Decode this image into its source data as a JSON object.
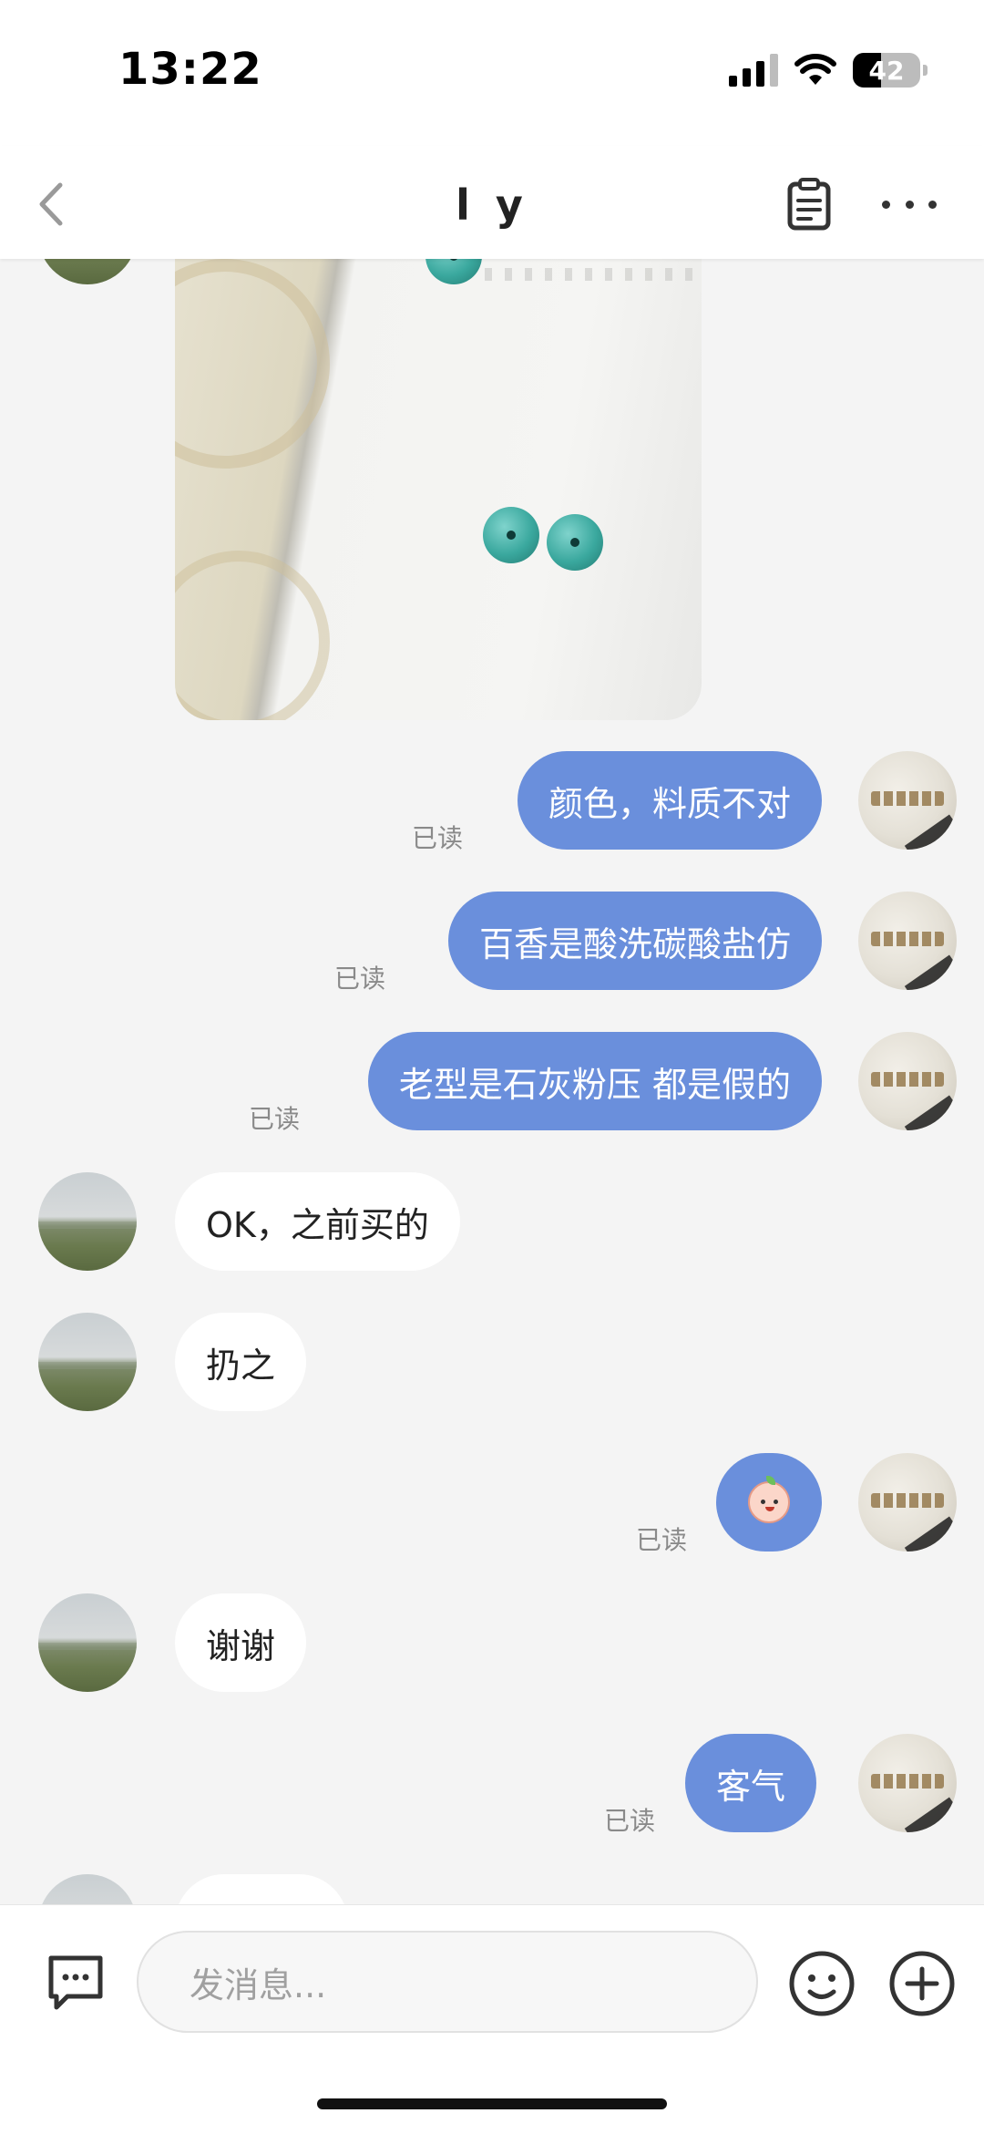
{
  "status_bar": {
    "time": "13:22",
    "battery": "42"
  },
  "nav": {
    "title": "l y"
  },
  "messages": [
    {
      "sender": "self",
      "text": "颜色，料质不对",
      "read": "已读"
    },
    {
      "sender": "self",
      "text": "百香是酸洗碳酸盐仿",
      "read": "已读"
    },
    {
      "sender": "self",
      "text": "老型是石灰粉压 都是假的",
      "read": "已读"
    },
    {
      "sender": "other",
      "text": "OK，之前买的"
    },
    {
      "sender": "other",
      "text": "扔之"
    },
    {
      "sender": "self",
      "emoji": "peach-face-emoji",
      "read": "已读"
    },
    {
      "sender": "other",
      "text": "谢谢"
    },
    {
      "sender": "self",
      "text": "客气",
      "read": "已读"
    }
  ],
  "input": {
    "placeholder": "发消息..."
  },
  "colors": {
    "out_bubble": "#6a8fdc",
    "in_bubble": "#ffffff",
    "background": "#f4f4f4"
  }
}
